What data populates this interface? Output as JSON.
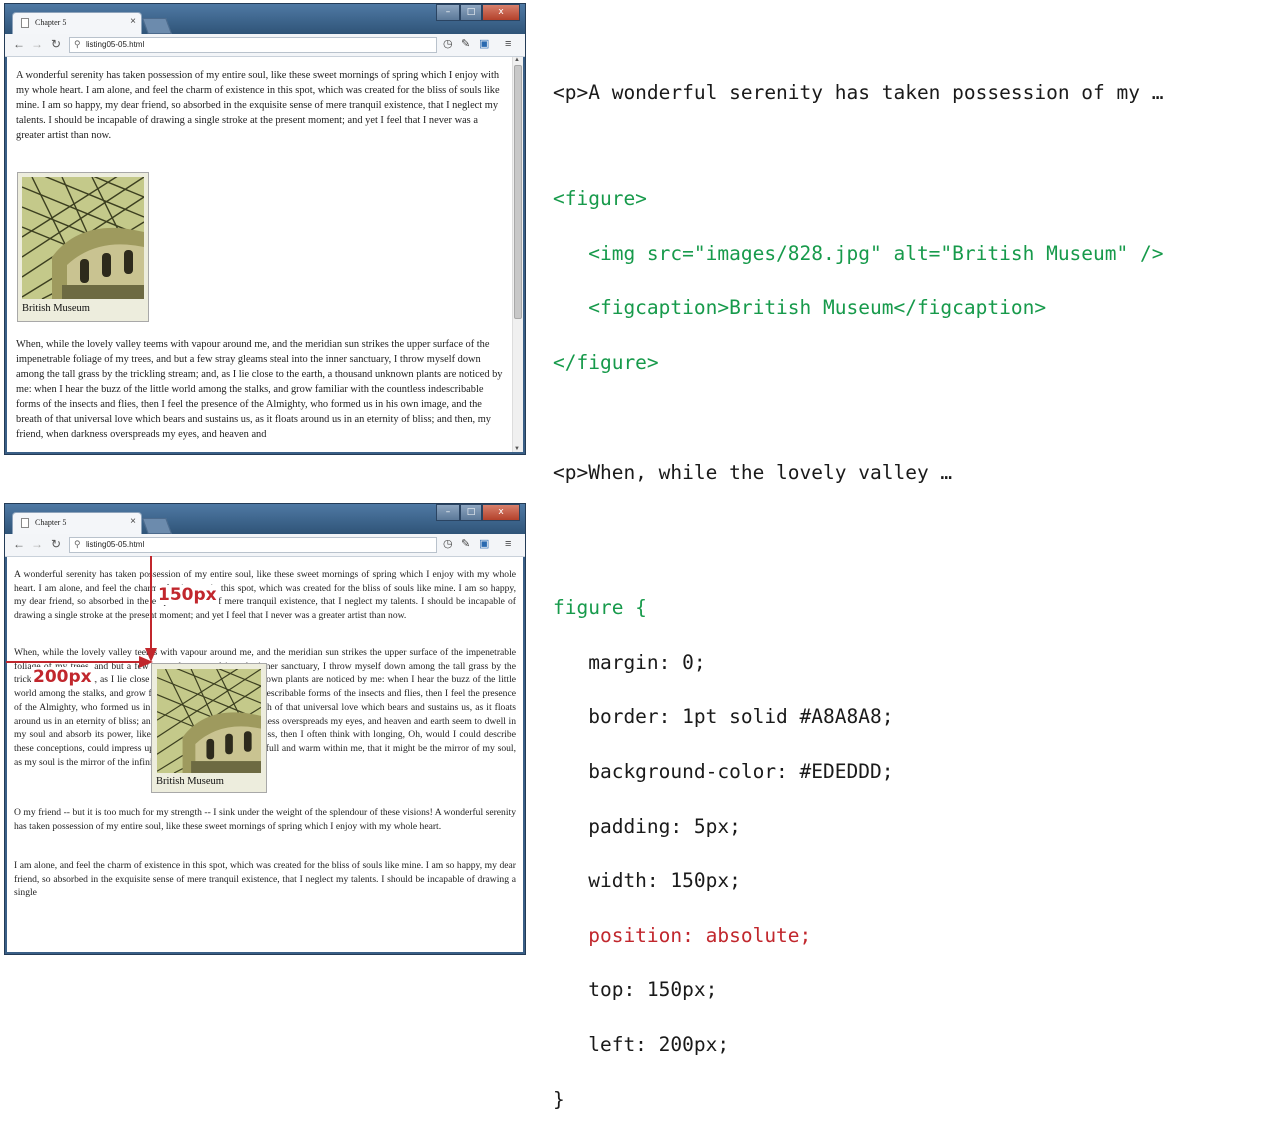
{
  "browser": {
    "tab_title": "Chapter 5",
    "tab_close": "×",
    "url_top": "listing05-05.html",
    "url_bottom": "listing05-05.html",
    "window_controls": {
      "minimize": "–",
      "maximize": "□",
      "close": "x"
    },
    "icons": [
      "back-icon",
      "forward-icon",
      "reload-icon",
      "search-icon",
      "page-icon",
      "wrench-icon",
      "menu-icon"
    ]
  },
  "top_page": {
    "para1": "A wonderful serenity has taken possession of my entire soul, like these sweet mornings of spring which I enjoy with my whole heart. I am alone, and feel the charm of existence in this spot, which was created for the bliss of souls like mine. I am so happy, my dear friend, so absorbed in the exquisite sense of mere tranquil existence, that I neglect my talents. I should be incapable of drawing a single stroke at the present moment; and yet I feel that I never was a greater artist than now.",
    "figcaption": "British Museum",
    "para2": "When, while the lovely valley teems with vapour around me, and the meridian sun strikes the upper surface of the impenetrable foliage of my trees, and but a few stray gleams steal into the inner sanctuary, I throw myself down among the tall grass by the trickling stream; and, as I lie close to the earth, a thousand unknown plants are noticed by me: when I hear the buzz of the little world among the stalks, and grow familiar with the countless indescribable forms of the insects and flies, then I feel the presence of the Almighty, who formed us in his own image, and the breath of that universal love which bears and sustains us, as it floats around us in an eternity of bliss; and then, my friend, when darkness overspreads my eyes, and heaven and"
  },
  "bottom_page": {
    "para1": "A wonderful serenity has taken possession of my entire soul, like these sweet mornings of spring which I enjoy with my whole heart. I am alone, and feel the charm of existence in this spot, which was created for the bliss of souls like mine. I am so happy, my dear friend, so absorbed in the exquisite sense of mere tranquil existence, that I neglect my talents. I should be incapable of drawing a single stroke at the present moment; and yet I feel that I never was a greater artist than now.",
    "para2": "When, while the lovely valley teems with vapour around me, and the meridian sun strikes the upper surface of the impenetrable foliage of my trees, and but a few stray gleams steal into the inner sanctuary, I throw myself down among the tall grass by the trickling stream; and, as I lie close to the earth, a thousand unknown plants are noticed by me: when I hear the buzz of the little world among the stalks, and grow familiar with the countless indescribable forms of the insects and flies, then I feel the presence of the Almighty, who formed us in his own image, and the breath of that universal love which bears and sustains us, as it floats around us in an eternity of bliss; and then, my friend, when darkness overspreads my eyes, and heaven and earth seem to dwell in my soul and absorb its power, like the form of a beloved mistress, then I often think with longing, Oh, would I could describe these conceptions, could impress upon paper all that is living so full and warm within me, that it might be the mirror of my soul, as my soul is the mirror of the infinite God!",
    "para3": "O my friend -- but it is too much for my strength -- I sink under the weight of the splendour of these visions! A wonderful serenity has taken possession of my entire soul, like these sweet mornings of spring which I enjoy with my whole heart.",
    "para4": "I am alone, and feel the charm of existence in this spot, which was created for the bliss of souls like mine. I am so happy, my dear friend, so absorbed in the exquisite sense of mere tranquil existence, that I neglect my talents. I should be incapable of drawing a single",
    "figcaption": "British Museum"
  },
  "annotations": {
    "top_offset": "150px",
    "left_offset": "200px"
  },
  "html_code": {
    "line1": "<p>A wonderful serenity has taken possession of my …",
    "line2": "<figure>",
    "line3": "   <img src=\"images/828.jpg\" alt=\"British Museum\" />",
    "line4": "   <figcaption>British Museum</figcaption>",
    "line5": "</figure>",
    "line6": "<p>When, while the lovely valley …"
  },
  "css_code": {
    "line1": "figure {",
    "line2": "   margin: 0;",
    "line3": "   border: 1pt solid #A8A8A8;",
    "line4": "   background-color: #EDEDDD;",
    "line5": "   padding: 5px;",
    "line6": "   width: 150px;",
    "line7": "   position: absolute;",
    "line8": "   top: 150px;",
    "line9": "   left: 200px;",
    "line10": "}"
  },
  "colors": {
    "code_green": "#179a4b",
    "code_red": "#c1272d",
    "figure_bg": "#EDEDDD",
    "figure_border": "#A8A8A8"
  }
}
